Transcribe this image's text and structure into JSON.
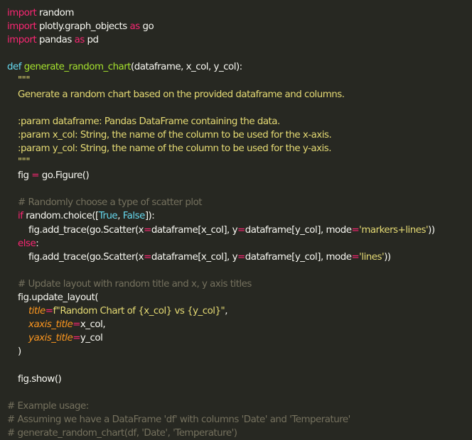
{
  "lines": [
    [
      {
        "t": "import",
        "c": "kw"
      },
      {
        "t": " random",
        "c": ""
      }
    ],
    [
      {
        "t": "import",
        "c": "kw"
      },
      {
        "t": " plotly.graph_objects ",
        "c": ""
      },
      {
        "t": "as",
        "c": "kw"
      },
      {
        "t": " go",
        "c": ""
      }
    ],
    [
      {
        "t": "import",
        "c": "kw"
      },
      {
        "t": " pandas ",
        "c": ""
      },
      {
        "t": "as",
        "c": "kw"
      },
      {
        "t": " pd",
        "c": ""
      }
    ],
    [],
    [
      {
        "t": "def",
        "c": "const"
      },
      {
        "t": " ",
        "c": ""
      },
      {
        "t": "generate_random_chart",
        "c": "fn"
      },
      {
        "t": "(dataframe, x_col, y_col):",
        "c": ""
      }
    ],
    [
      {
        "t": "    \"\"\"",
        "c": "str"
      }
    ],
    [
      {
        "t": "    Generate a random chart based on the provided dataframe and columns.",
        "c": "str"
      }
    ],
    [],
    [
      {
        "t": "    :param dataframe: Pandas DataFrame containing the data.",
        "c": "str"
      }
    ],
    [
      {
        "t": "    :param x_col: String, the name of the column to be used for the x-axis.",
        "c": "str"
      }
    ],
    [
      {
        "t": "    :param y_col: String, the name of the column to be used for the y-axis.",
        "c": "str"
      }
    ],
    [
      {
        "t": "    \"\"\"",
        "c": "str"
      }
    ],
    [
      {
        "t": "    fig ",
        "c": ""
      },
      {
        "t": "=",
        "c": "op"
      },
      {
        "t": " go.Figure()",
        "c": ""
      }
    ],
    [],
    [
      {
        "t": "    # Randomly choose a type of scatter plot",
        "c": "cmt"
      }
    ],
    [
      {
        "t": "    ",
        "c": ""
      },
      {
        "t": "if",
        "c": "kw"
      },
      {
        "t": " random.choice([",
        "c": ""
      },
      {
        "t": "True",
        "c": "const"
      },
      {
        "t": ", ",
        "c": ""
      },
      {
        "t": "False",
        "c": "const"
      },
      {
        "t": "]):",
        "c": ""
      }
    ],
    [
      {
        "t": "        fig.add_trace(go.Scatter(x",
        "c": ""
      },
      {
        "t": "=",
        "c": "op"
      },
      {
        "t": "dataframe[x_col], y",
        "c": ""
      },
      {
        "t": "=",
        "c": "op"
      },
      {
        "t": "dataframe[y_col], mode",
        "c": ""
      },
      {
        "t": "=",
        "c": "op"
      },
      {
        "t": "'markers+lines'",
        "c": "str"
      },
      {
        "t": "))",
        "c": ""
      }
    ],
    [
      {
        "t": "    ",
        "c": ""
      },
      {
        "t": "else",
        "c": "kw"
      },
      {
        "t": ":",
        "c": ""
      }
    ],
    [
      {
        "t": "        fig.add_trace(go.Scatter(x",
        "c": ""
      },
      {
        "t": "=",
        "c": "op"
      },
      {
        "t": "dataframe[x_col], y",
        "c": ""
      },
      {
        "t": "=",
        "c": "op"
      },
      {
        "t": "dataframe[y_col], mode",
        "c": ""
      },
      {
        "t": "=",
        "c": "op"
      },
      {
        "t": "'lines'",
        "c": "str"
      },
      {
        "t": "))",
        "c": ""
      }
    ],
    [],
    [
      {
        "t": "    # Update layout with random title and x, y axis titles",
        "c": "cmt"
      }
    ],
    [
      {
        "t": "    fig.update_layout(",
        "c": ""
      }
    ],
    [
      {
        "t": "        title",
        "c": "param"
      },
      {
        "t": "=",
        "c": "op"
      },
      {
        "t": "f\"Random Chart of {x_col} vs {y_col}\"",
        "c": "str"
      },
      {
        "t": ",",
        "c": ""
      }
    ],
    [
      {
        "t": "        xaxis_title",
        "c": "param"
      },
      {
        "t": "=",
        "c": "op"
      },
      {
        "t": "x_col,",
        "c": ""
      }
    ],
    [
      {
        "t": "        yaxis_title",
        "c": "param"
      },
      {
        "t": "=",
        "c": "op"
      },
      {
        "t": "y_col",
        "c": ""
      }
    ],
    [
      {
        "t": "    )",
        "c": ""
      }
    ],
    [],
    [
      {
        "t": "    fig.show()",
        "c": ""
      }
    ],
    [],
    [
      {
        "t": "# Example usage:",
        "c": "cmt"
      }
    ],
    [
      {
        "t": "# Assuming we have a DataFrame 'df' with columns 'Date' and 'Temperature'",
        "c": "cmt"
      }
    ],
    [
      {
        "t": "# generate_random_chart(df, 'Date', 'Temperature')",
        "c": "cmt"
      }
    ]
  ]
}
